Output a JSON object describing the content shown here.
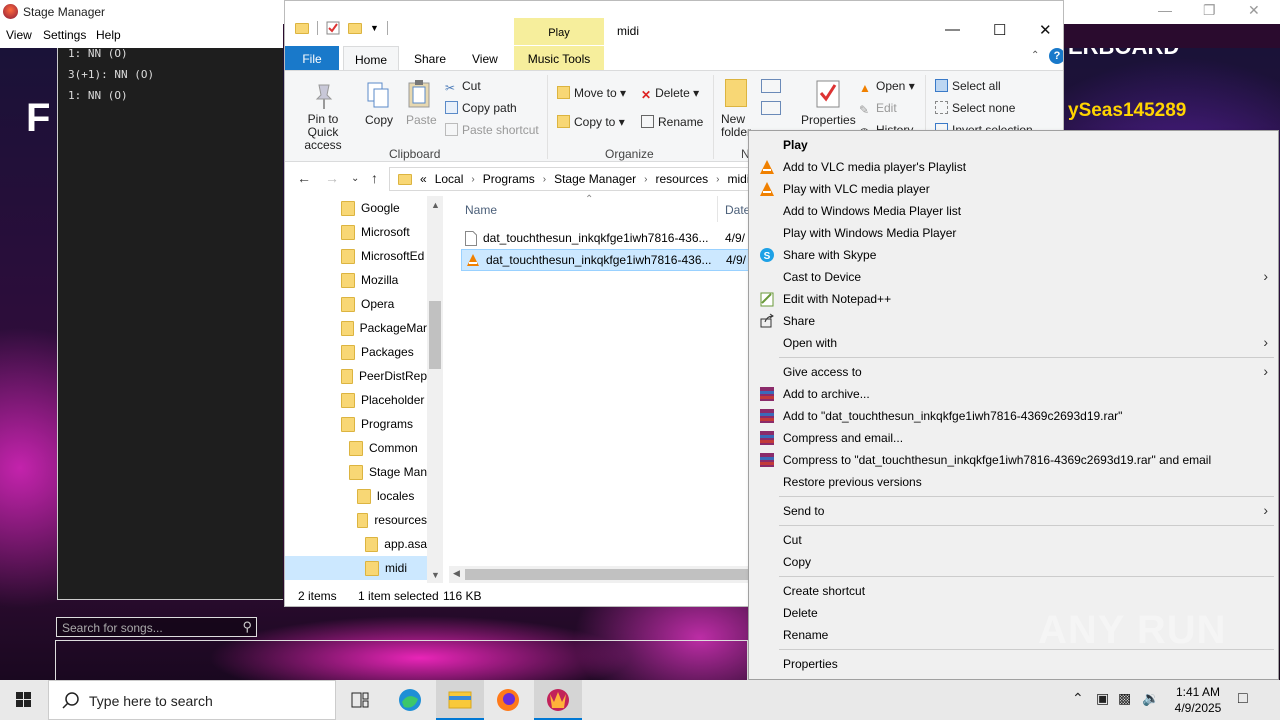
{
  "stage_manager": {
    "title": "Stage Manager",
    "menu": [
      "View",
      "Settings",
      "Help"
    ],
    "log_lines": [
      "1: NN (O)",
      "3(+1): NN (O)",
      "1: NN (O)"
    ],
    "search_placeholder": "Search for songs...",
    "bg_letter": "F",
    "bg_leaderboard": "ERBOARD",
    "bg_user": "ySeas145289"
  },
  "explorer": {
    "window_title": "midi",
    "contextual_tab_group": "Play",
    "tabs": [
      "File",
      "Home",
      "Share",
      "View",
      "Music Tools"
    ],
    "ribbon": {
      "clipboard": {
        "pin": "Pin to Quick access",
        "copy": "Copy",
        "paste": "Paste",
        "cut": "Cut",
        "copy_path": "Copy path",
        "paste_shortcut": "Paste shortcut",
        "group": "Clipboard"
      },
      "organize": {
        "move_to": "Move to",
        "copy_to": "Copy to",
        "delete": "Delete",
        "rename": "Rename",
        "group": "Organize"
      },
      "new": {
        "new_folder": "New folder",
        "group": "N"
      },
      "open": {
        "properties": "Properties",
        "open": "Open",
        "edit": "Edit",
        "history": "History"
      },
      "select": {
        "select_all": "Select all",
        "select_none": "Select none",
        "invert": "Invert selection"
      }
    },
    "address": {
      "prefix": "«",
      "crumbs": [
        "Local",
        "Programs",
        "Stage Manager",
        "resources",
        "midi"
      ]
    },
    "tree": [
      {
        "label": "Google",
        "indent": 0
      },
      {
        "label": "Microsoft",
        "indent": 0
      },
      {
        "label": "MicrosoftEd",
        "indent": 0
      },
      {
        "label": "Mozilla",
        "indent": 0
      },
      {
        "label": "Opera",
        "indent": 0
      },
      {
        "label": "PackageMar",
        "indent": 0
      },
      {
        "label": "Packages",
        "indent": 0
      },
      {
        "label": "PeerDistRep",
        "indent": 0
      },
      {
        "label": "Placeholder",
        "indent": 0
      },
      {
        "label": "Programs",
        "indent": 0
      },
      {
        "label": "Common",
        "indent": 1
      },
      {
        "label": "Stage Man",
        "indent": 1
      },
      {
        "label": "locales",
        "indent": 2
      },
      {
        "label": "resources",
        "indent": 2
      },
      {
        "label": "app.asa",
        "indent": 3
      },
      {
        "label": "midi",
        "indent": 3
      }
    ],
    "columns": {
      "name": "Name",
      "date": "Date"
    },
    "files": [
      {
        "name": "dat_touchthesun_inkqkfge1iwh7816-436...",
        "date": "4/9/"
      },
      {
        "name": "dat_touchthesun_inkqkfge1iwh7816-436...",
        "date": "4/9/"
      }
    ],
    "status": {
      "items": "2 items",
      "selected": "1 item selected",
      "size": "116 KB"
    }
  },
  "context_menu": {
    "items": [
      {
        "label": "Play",
        "bold": true,
        "icon": ""
      },
      {
        "label": "Add to VLC media player's Playlist",
        "icon": "vlc-icon"
      },
      {
        "label": "Play with VLC media player",
        "icon": "vlc-icon"
      },
      {
        "label": "Add to Windows Media Player list",
        "icon": ""
      },
      {
        "label": "Play with Windows Media Player",
        "icon": ""
      },
      {
        "label": "Share with Skype",
        "icon": "skype-icon"
      },
      {
        "label": "Cast to Device",
        "icon": "",
        "submenu": true
      },
      {
        "label": "Edit with Notepad++",
        "icon": "notepadpp-icon"
      },
      {
        "label": "Share",
        "icon": "share-icon"
      },
      {
        "label": "Open with",
        "icon": "",
        "submenu": true
      },
      {
        "label": "Give access to",
        "icon": "",
        "submenu": true
      },
      {
        "label": "Add to archive...",
        "icon": "winrar-icon"
      },
      {
        "label": "Add to \"dat_touchthesun_inkqkfge1iwh7816-4369c2693d19.rar\"",
        "icon": "winrar-icon"
      },
      {
        "label": "Compress and email...",
        "icon": "winrar-icon"
      },
      {
        "label": "Compress to \"dat_touchthesun_inkqkfge1iwh7816-4369c2693d19.rar\" and email",
        "icon": "winrar-icon"
      },
      {
        "label": "Restore previous versions",
        "icon": ""
      },
      {
        "label": "Send to",
        "icon": "",
        "submenu": true
      },
      {
        "label": "Cut",
        "icon": ""
      },
      {
        "label": "Copy",
        "icon": ""
      },
      {
        "label": "Create shortcut",
        "icon": ""
      },
      {
        "label": "Delete",
        "icon": ""
      },
      {
        "label": "Rename",
        "icon": ""
      },
      {
        "label": "Properties",
        "icon": ""
      }
    ]
  },
  "taskbar": {
    "search_placeholder": "Type here to search",
    "time": "1:41 AM",
    "date": "4/9/2025"
  },
  "watermark": "ANY RUN",
  "colors": {
    "ribbon_blue": "#1979ca",
    "play_yellow": "#f6ee9c",
    "selection": "#cce8ff",
    "folder_yellow": "#f8d775"
  }
}
